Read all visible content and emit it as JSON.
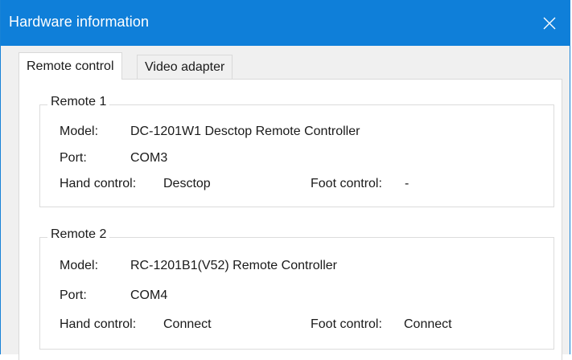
{
  "window": {
    "title": "Hardware information",
    "close_icon": "close-icon"
  },
  "tabs": [
    {
      "label": "Remote control",
      "active": true
    },
    {
      "label": "Video adapter",
      "active": false
    }
  ],
  "remotes": [
    {
      "group_label": "Remote 1",
      "model_label": "Model:",
      "model_value": "DC-1201W1 Desctop Remote Controller",
      "port_label": "Port:",
      "port_value": "COM3",
      "hand_label": "Hand control:",
      "hand_value": "Desctop",
      "foot_label": "Foot control:",
      "foot_value": "-"
    },
    {
      "group_label": "Remote 2",
      "model_label": "Model:",
      "model_value": "RC-1201B1(V52) Remote Controller",
      "port_label": "Port:",
      "port_value": "COM4",
      "hand_label": "Hand control:",
      "hand_value": "Connect",
      "foot_label": "Foot control:",
      "foot_value": "Connect"
    }
  ],
  "colors": {
    "titlebar": "#0f7fd9",
    "window_bg": "#f0f0f0",
    "panel_bg": "#ffffff"
  }
}
